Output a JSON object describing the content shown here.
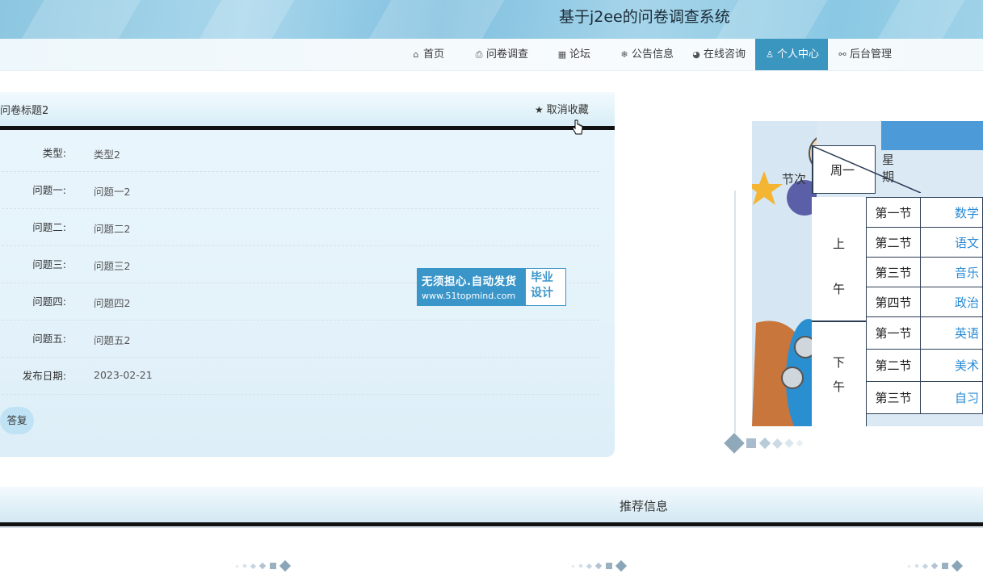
{
  "header": {
    "title": "基于j2ee的问卷调查系统"
  },
  "nav": {
    "items": [
      {
        "icon": "home-icon",
        "glyph": "⌂",
        "label": "首页"
      },
      {
        "icon": "printer-icon",
        "glyph": "⎙",
        "label": "问卷调查"
      },
      {
        "icon": "grid-icon",
        "glyph": "▦",
        "label": "论坛"
      },
      {
        "icon": "snowflake-icon",
        "glyph": "❄",
        "label": "公告信息"
      },
      {
        "icon": "chat-icon",
        "glyph": "◕",
        "label": "在线咨询"
      },
      {
        "icon": "user-icon",
        "glyph": "♙",
        "label": "个人中心",
        "active": true
      },
      {
        "icon": "link-icon",
        "glyph": "⚯",
        "label": "后台管理"
      }
    ]
  },
  "detail": {
    "title": "问卷标题2",
    "favorite_label": "取消收藏",
    "fields": [
      {
        "label": "类型:",
        "value": "类型2"
      },
      {
        "label": "问题一:",
        "value": "问题一2"
      },
      {
        "label": "问题二:",
        "value": "问题二2"
      },
      {
        "label": "问题三:",
        "value": "问题三2"
      },
      {
        "label": "问题四:",
        "value": "问题四2"
      },
      {
        "label": "问题五:",
        "value": "问题五2"
      },
      {
        "label": "发布日期:",
        "value": "2023-02-21"
      }
    ],
    "reply_label": "答复"
  },
  "watermark": {
    "line1": "无须担心.自动发货",
    "line2": "www.51topmind.com",
    "right1": "毕业",
    "right2": "设计"
  },
  "schedule": {
    "header_week": "星期",
    "header_period": "节次",
    "header_day": "周一",
    "morning": "上午",
    "afternoon": "下午",
    "rows": [
      {
        "period": "第一节",
        "subject": "数学"
      },
      {
        "period": "第二节",
        "subject": "语文"
      },
      {
        "period": "第三节",
        "subject": "音乐"
      },
      {
        "period": "第四节",
        "subject": "政治"
      },
      {
        "period": "第一节",
        "subject": "英语"
      },
      {
        "period": "第二节",
        "subject": "美术"
      },
      {
        "period": "第三节",
        "subject": "自习"
      }
    ]
  },
  "recommend": {
    "title": "推荐信息"
  },
  "colors": {
    "accent": "#3a95bf",
    "banner": "#8cc6e0",
    "card_bg": "#e4f2fa"
  }
}
